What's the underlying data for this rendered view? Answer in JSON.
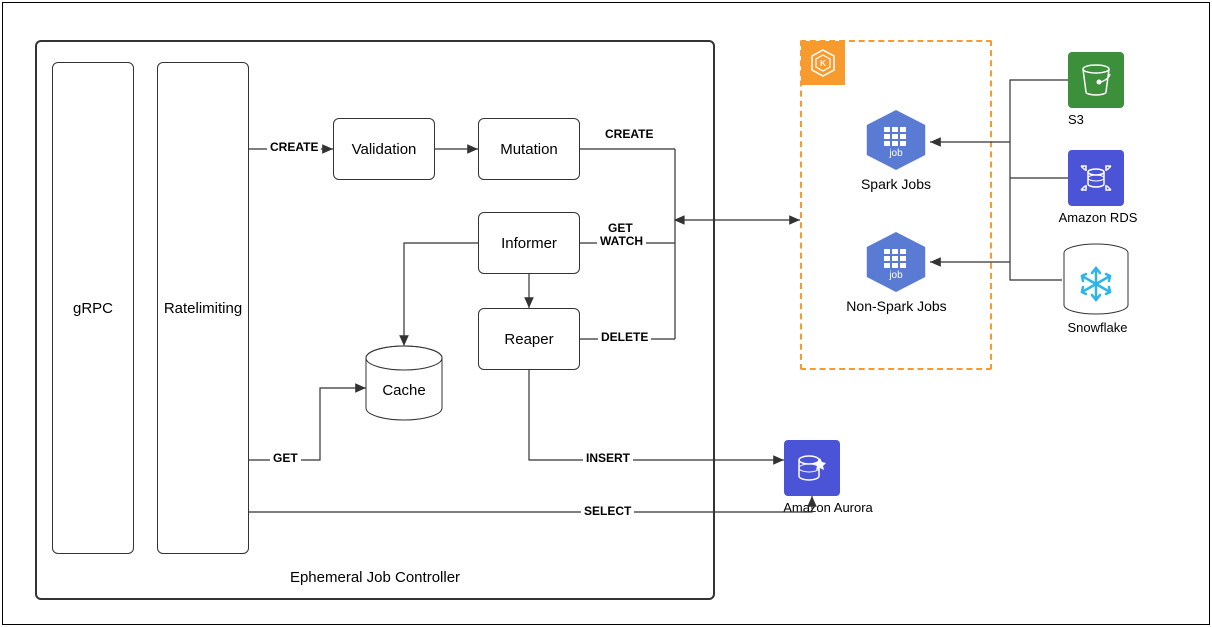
{
  "controller": {
    "title": "Ephemeral Job Controller",
    "grpc": "gRPC",
    "ratelimiting": "Ratelimiting"
  },
  "nodes": {
    "validation": "Validation",
    "mutation": "Mutation",
    "informer": "Informer",
    "reaper": "Reaper",
    "cache": "Cache"
  },
  "edges": {
    "rl_create": "CREATE",
    "mut_create": "CREATE",
    "inf_getwatch1": "GET",
    "inf_getwatch2": "WATCH",
    "reaper_delete": "DELETE",
    "reaper_insert": "INSERT",
    "rl_get": "GET",
    "rl_select": "SELECT"
  },
  "kubernetes": {
    "spark_label": "Spark Jobs",
    "nonspark_label": "Non-Spark Jobs",
    "job_badge": "job"
  },
  "aws": {
    "aurora": "Amazon Aurora",
    "s3": "S3",
    "rds": "Amazon RDS",
    "snowflake": "Snowflake"
  }
}
